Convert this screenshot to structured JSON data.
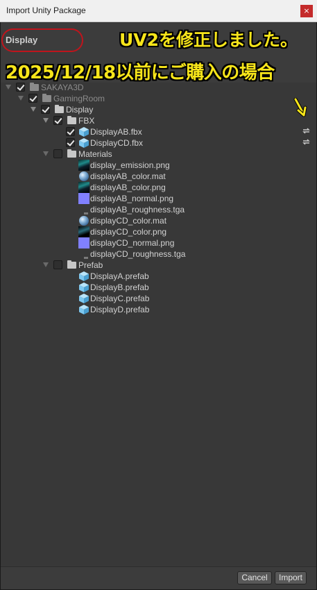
{
  "window": {
    "title": "Import Unity Package",
    "close_glyph": "×"
  },
  "package": {
    "name": "Display"
  },
  "annotations": {
    "line1": "UV2を修正しました。",
    "line2": "2025/12/18以前にご購入の場合",
    "color": "#f7e51a",
    "oval_color": "#c0141c"
  },
  "tree": [
    {
      "label": "SAKAYA3D",
      "icon": "folder-icon",
      "checked": true,
      "dim": true
    },
    {
      "label": "GamingRoom",
      "icon": "folder-icon",
      "checked": true,
      "dim": true
    },
    {
      "label": "Display",
      "icon": "folder-icon",
      "checked": true,
      "dim": false
    },
    {
      "label": "FBX",
      "icon": "folder-icon",
      "checked": true,
      "dim": false
    },
    {
      "label": "DisplayAB.fbx",
      "icon": "prefab-cube-icon",
      "checked": true,
      "dim": false,
      "reimport": true
    },
    {
      "label": "DisplayCD.fbx",
      "icon": "prefab-cube-icon",
      "checked": true,
      "dim": false,
      "reimport": true
    },
    {
      "label": "Materials",
      "icon": "folder-icon",
      "checked": false,
      "dim": false
    },
    {
      "label": "display_emission.png",
      "icon": "texture-icon"
    },
    {
      "label": "displayAB_color.mat",
      "icon": "material-icon"
    },
    {
      "label": "displayAB_color.png",
      "icon": "texture-icon"
    },
    {
      "label": "displayAB_normal.png",
      "icon": "normal-map-icon"
    },
    {
      "label": "displayAB_roughness.tga",
      "icon": "tga-icon"
    },
    {
      "label": "displayCD_color.mat",
      "icon": "material-icon"
    },
    {
      "label": "displayCD_color.png",
      "icon": "texture-icon"
    },
    {
      "label": "displayCD_normal.png",
      "icon": "normal-map-icon"
    },
    {
      "label": "displayCD_roughness.tga",
      "icon": "tga-icon"
    },
    {
      "label": "Prefab",
      "icon": "folder-icon",
      "checked": false,
      "dim": false
    },
    {
      "label": "DisplayA.prefab",
      "icon": "prefab-cube-icon"
    },
    {
      "label": "DisplayB.prefab",
      "icon": "prefab-cube-icon"
    },
    {
      "label": "DisplayC.prefab",
      "icon": "prefab-cube-icon"
    },
    {
      "label": "DisplayD.prefab",
      "icon": "prefab-cube-icon"
    }
  ],
  "buttons": {
    "cancel": "Cancel",
    "import": "Import"
  },
  "colors": {
    "background": "#383838",
    "normal_map": "#8080ff",
    "prefab_cube": "#7ec8f0"
  }
}
